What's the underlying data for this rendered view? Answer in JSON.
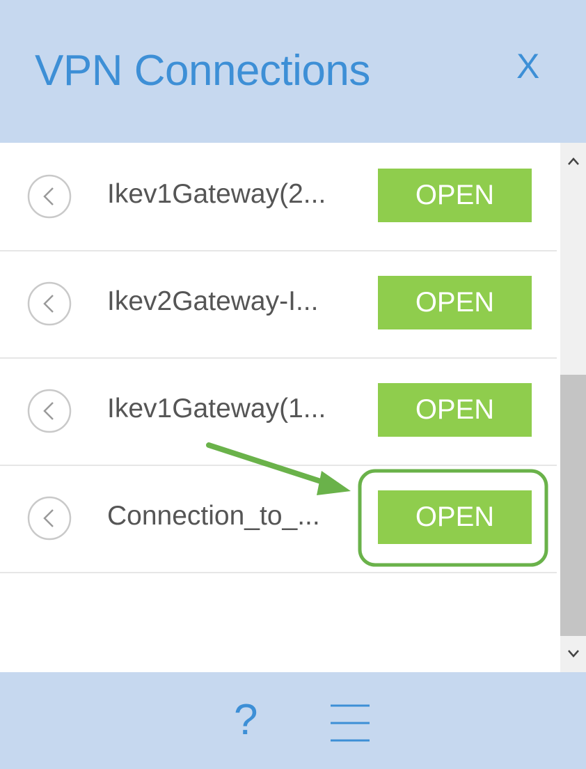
{
  "header": {
    "title": "VPN Connections",
    "close_label": "X"
  },
  "connections": [
    {
      "label": "Ikev1Gateway(2...",
      "action_label": "OPEN"
    },
    {
      "label": "Ikev2Gateway-I...",
      "action_label": "OPEN"
    },
    {
      "label": "Ikev1Gateway(1...",
      "action_label": "OPEN"
    },
    {
      "label": "Connection_to_...",
      "action_label": "OPEN"
    }
  ],
  "footer": {
    "help_label": "?",
    "menu_icon": "hamburger-menu-icon"
  },
  "icons": {
    "row_icon": "chevron-left-circle-icon",
    "scroll_up": "chevron-up-icon",
    "scroll_down": "chevron-down-icon",
    "annotation": "arrow-pointer-icon"
  },
  "colors": {
    "header_bg": "#c6d8ef",
    "accent_blue": "#3d8fd6",
    "open_button": "#8fcd4d",
    "annotation_green": "#6ab24a"
  }
}
